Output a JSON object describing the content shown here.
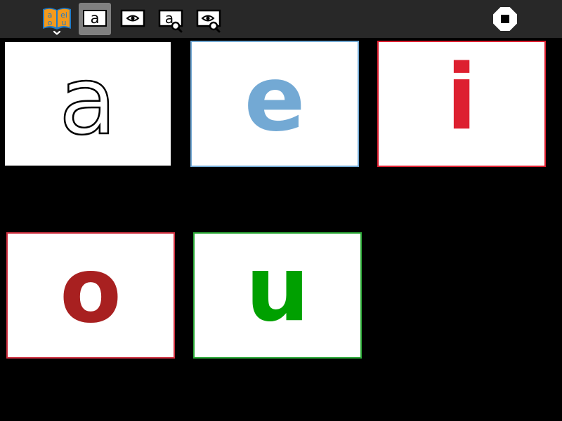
{
  "toolbar": {
    "activity_icon_text": "aeiou",
    "letter_tool_text": "a",
    "letter_zoom_tool_text": "a"
  },
  "cards": [
    {
      "letter": "a",
      "color": "#ffffff",
      "outline": "#000000",
      "border": "#ffffff"
    },
    {
      "letter": "e",
      "color": "#73a9d4",
      "border": "#73a9d4"
    },
    {
      "letter": "i",
      "color": "#dd2030",
      "border": "#dd2030"
    },
    {
      "letter": "o",
      "color": "#a82020",
      "border": "#d03040"
    },
    {
      "letter": "u",
      "color": "#00a000",
      "border": "#2aa836"
    }
  ],
  "colors": {
    "toolbar_bg": "#282828",
    "canvas_bg": "#000000",
    "active_button_bg": "#808080",
    "activity_icon_orange": "#f39a1c",
    "activity_icon_blue": "#1e7ac8"
  },
  "icons": [
    "activity-aeiou-icon",
    "letter-display-icon",
    "eye-icon",
    "letter-magnify-icon",
    "eye-magnify-icon",
    "stop-icon"
  ]
}
